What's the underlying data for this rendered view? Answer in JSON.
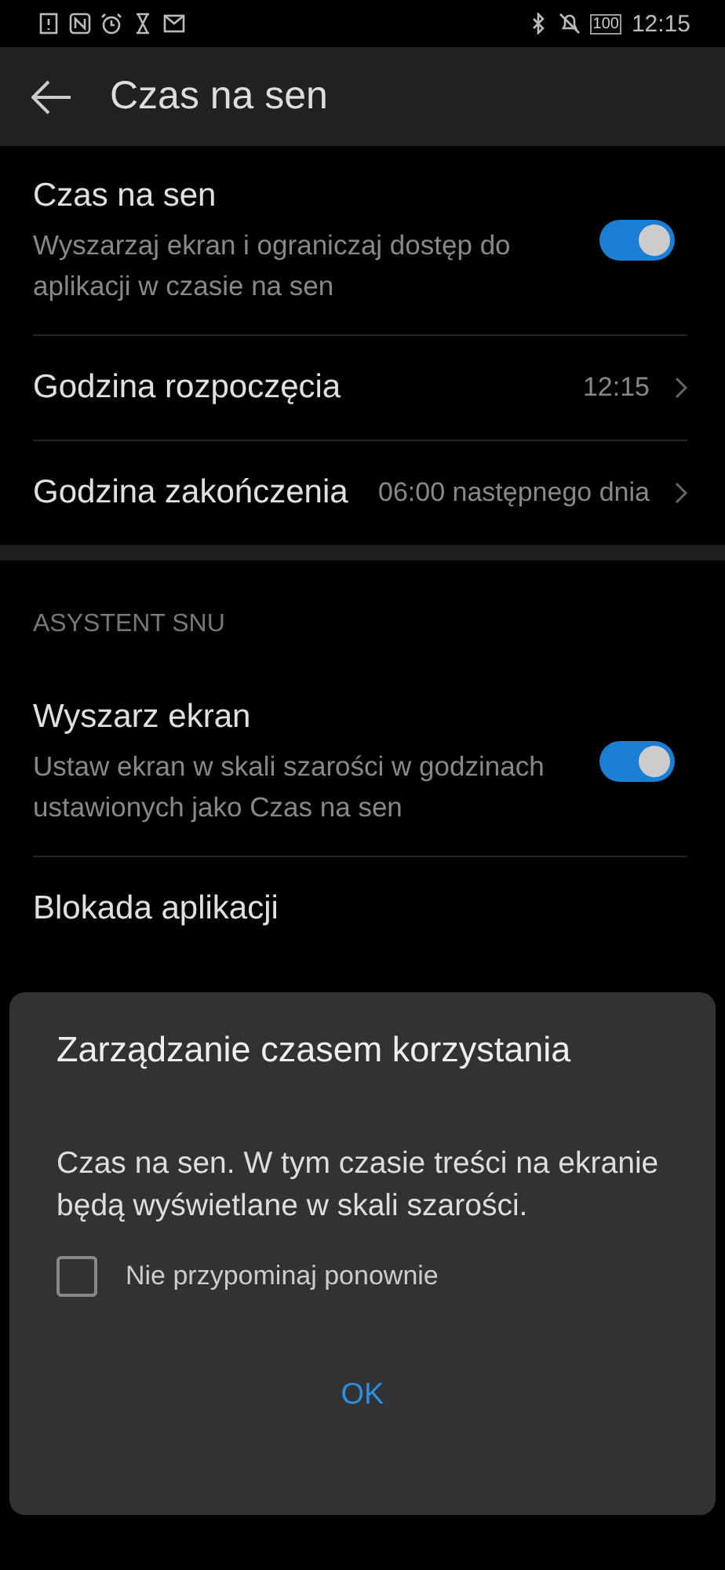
{
  "status_bar": {
    "battery": "100",
    "time": "12:15"
  },
  "toolbar": {
    "title": "Czas na sen"
  },
  "sections": [
    {
      "items": [
        {
          "kind": "toggle",
          "title": "Czas na sen",
          "subtitle": "Wyszarzaj ekran i ograniczaj dostęp do aplikacji w czasie na sen",
          "on": true
        },
        {
          "kind": "link",
          "title": "Godzina rozpoczęcia",
          "value": "12:15"
        },
        {
          "kind": "link",
          "title": "Godzina zakończenia",
          "value": "06:00 następnego dnia"
        }
      ]
    },
    {
      "header": "ASYSTENT SNU",
      "items": [
        {
          "kind": "toggle",
          "title": "Wyszarz ekran",
          "subtitle": "Ustaw ekran w skali szarości w godzinach ustawionych jako Czas na sen",
          "on": true
        },
        {
          "kind": "link",
          "title": "Blokada aplikacji"
        }
      ]
    }
  ],
  "dialog": {
    "title": "Zarządzanie czasem korzystania",
    "message": "Czas na sen. W tym czasie treści na ekranie będą wyświetlane w skali szarości.",
    "checkbox": {
      "label": "Nie przypominaj ponownie",
      "checked": false
    },
    "button": "OK"
  }
}
